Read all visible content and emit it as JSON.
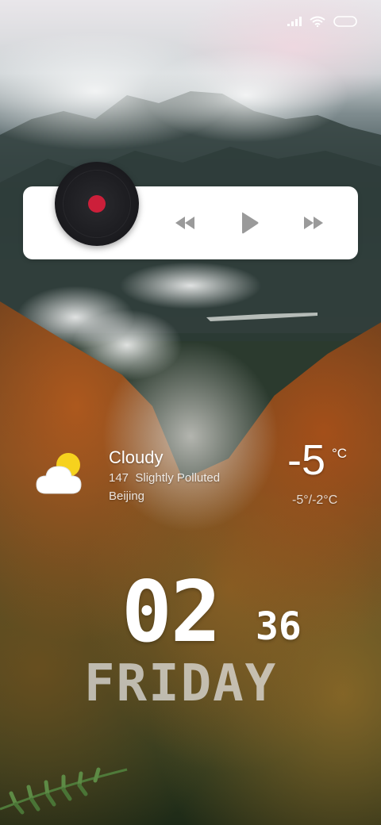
{
  "status_bar": {
    "icons": [
      "signal-icon",
      "wifi-icon",
      "battery-icon"
    ]
  },
  "music_widget": {
    "controls": [
      "previous-icon",
      "play-icon",
      "next-icon"
    ],
    "colors": {
      "card": "#ffffff",
      "disc": "#1d1d21",
      "disc_center": "#cc1f3a",
      "controls": "#9a9a9a"
    }
  },
  "weather": {
    "icon": "partly-cloudy-icon",
    "condition": "Cloudy",
    "aqi_line": "147  Slightly Polluted",
    "city": "Beijing",
    "temperature": "-5",
    "unit": "°C",
    "range": "-5°/-2°C"
  },
  "clock": {
    "hour": "02",
    "minute": "36",
    "day": "FRIDAY"
  }
}
